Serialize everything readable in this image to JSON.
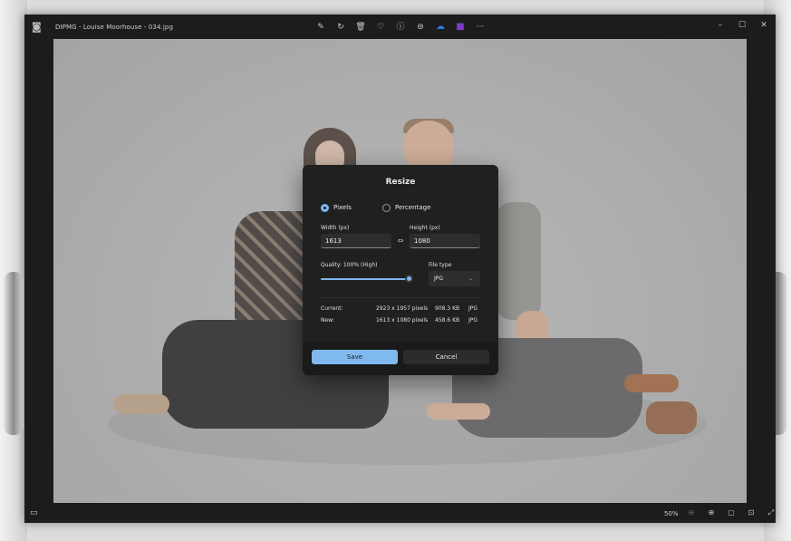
{
  "window": {
    "title": "DIPMG - Louise Moorhouse - 034.jpg"
  },
  "toolbar": {
    "icons": [
      "edit-icon",
      "rotate-icon",
      "delete-icon",
      "heart-icon",
      "info-icon",
      "edit-with-icon",
      "onedrive-icon",
      "clipchamp-icon",
      "more-icon"
    ],
    "more_label": "···"
  },
  "window_controls": {
    "minimize": "–",
    "maximize": "☐",
    "close": "✕"
  },
  "statusbar": {
    "zoom": "50%"
  },
  "dialog": {
    "title": "Resize",
    "options": {
      "pixels": "Pixels",
      "percentage": "Percentage",
      "selected": "Pixels"
    },
    "width": {
      "label": "Width  (px)",
      "value": "1613"
    },
    "height": {
      "label": "Height  (px)",
      "value": "1080"
    },
    "quality": {
      "label": "Quality: 100% (High)",
      "percent": 100
    },
    "file_type": {
      "label": "File type",
      "value": "JPG"
    },
    "current": {
      "label": "Current:",
      "dimensions": "2923 x 1957 pixels",
      "size": "908.3 KB",
      "type": "JPG"
    },
    "new": {
      "label": "New:",
      "dimensions": "1613 x 1080 pixels",
      "size": "458.6 KB",
      "type": "JPG"
    },
    "save_label": "Save",
    "cancel_label": "Cancel"
  },
  "colors": {
    "accent": "#7fb9ee",
    "dialog_bg": "#202020"
  }
}
